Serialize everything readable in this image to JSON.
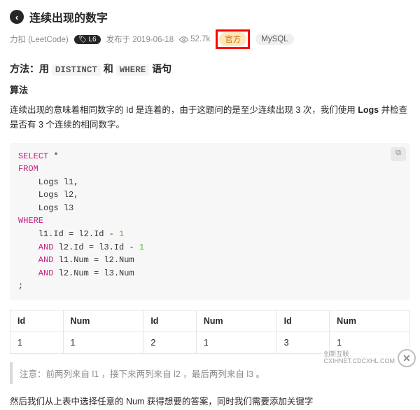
{
  "header": {
    "back_glyph": "‹",
    "title": "连续出现的数字"
  },
  "meta": {
    "author": "力扣 (LeetCode)",
    "level_badge": "L6",
    "published_prefix": "发布于",
    "published_date": "2019-06-18",
    "views": "52.7k",
    "tag_official": "官方",
    "tag_tech": "MySQL"
  },
  "method": {
    "prefix": "方法：用",
    "kw1": "DISTINCT",
    "mid": "和",
    "kw2": "WHERE",
    "suffix": "语句"
  },
  "algo_heading": "算法",
  "paragraph": {
    "p1_a": "连续出现的意味着相同数字的 Id 是连着的，由于这题问的是至少连续出现 3 次，我们使用 ",
    "p1_b": "Logs",
    "p1_c": " 并检查是否有 3 个连续的相同数字。"
  },
  "code": {
    "copy_hint": "⧉",
    "l1_kw": "SELECT",
    "l1_rest": " *",
    "l2_kw": "FROM",
    "l3": "    Logs l1,",
    "l4": "    Logs l2,",
    "l5": "    Logs l3",
    "l6_kw": "WHERE",
    "l7_a": "    l1.Id ",
    "l7_op": "=",
    "l7_b": " l2.Id ",
    "l7_op2": "-",
    "l7_num": " 1",
    "l8_kw": "    AND",
    "l8_a": " l2.Id ",
    "l8_op": "=",
    "l8_b": " l3.Id ",
    "l8_op2": "-",
    "l8_num": " 1",
    "l9_kw": "    AND",
    "l9_a": " l1.Num ",
    "l9_op": "=",
    "l9_b": " l2.Num",
    "l10_kw": "    AND",
    "l10_a": " l2.Num ",
    "l10_op": "=",
    "l10_b": " l3.Num",
    "l11": ";"
  },
  "table": {
    "headers": [
      "Id",
      "Num",
      "Id",
      "Num",
      "Id",
      "Num"
    ],
    "rows": [
      [
        "1",
        "1",
        "2",
        "1",
        "3",
        "1"
      ]
    ]
  },
  "note": "注意：前两列来自 l1 ，接下来两列来自 l2 ，最后两列来自 l3 。",
  "footer_cut": "然后我们从上表中选择任意的 Num 获得想要的答案，同时我们需要添加关键字",
  "watermark": {
    "line1": "创新互联",
    "line2": "CXIHNET.CDCXHL.COM"
  },
  "chart_data": {
    "type": "table",
    "title": "三表自连接示例行",
    "headers": [
      "Id",
      "Num",
      "Id",
      "Num",
      "Id",
      "Num"
    ],
    "rows": [
      [
        1,
        1,
        2,
        1,
        3,
        1
      ]
    ],
    "note": "前两列来自 l1，接下来两列来自 l2，最后两列来自 l3"
  }
}
